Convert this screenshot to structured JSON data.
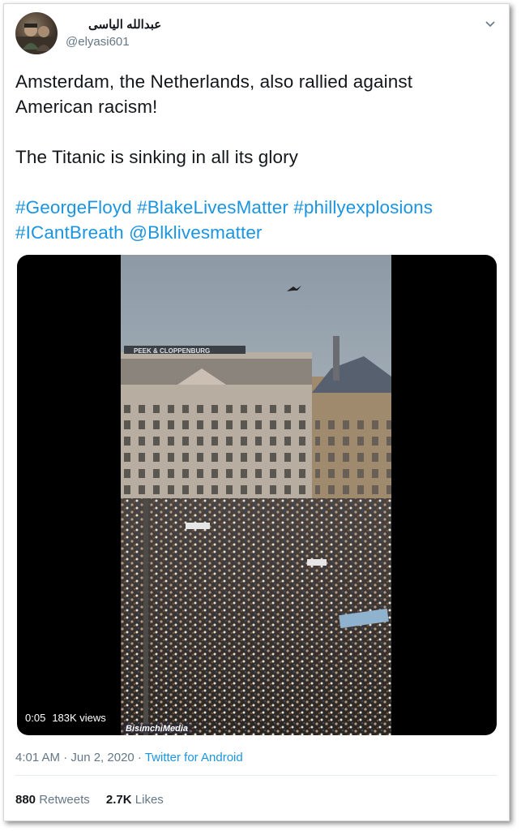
{
  "tweet": {
    "author_name": "عبدالله الیاسی",
    "author_handle": "@elyasi601",
    "lines": [
      "Amsterdam, the Netherlands, also rallied against American racism!",
      "The Titanic is sinking in all its glory"
    ],
    "hashtags": [
      "#GeorgeFloyd",
      "#BlakeLivesMatter",
      "#phillyexplosions",
      "#ICantBreath",
      "@Blklivesmatter"
    ],
    "menu_icon": "chevron-down-icon"
  },
  "video": {
    "duration": "0:05",
    "views": "183K views",
    "watermark": "BisimchiMedia",
    "building_sign": "PEEK & CLOPPENBURG"
  },
  "meta": {
    "time": "4:01 AM · Jun 2, 2020 · ",
    "app": "Twitter for Android"
  },
  "stats": {
    "retweets_count": "880",
    "retweets_label": "Retweets",
    "likes_count": "2.7K",
    "likes_label": "Likes"
  },
  "colors": {
    "link": "#1b95e0",
    "secondary": "#657786",
    "text": "#14171a"
  }
}
